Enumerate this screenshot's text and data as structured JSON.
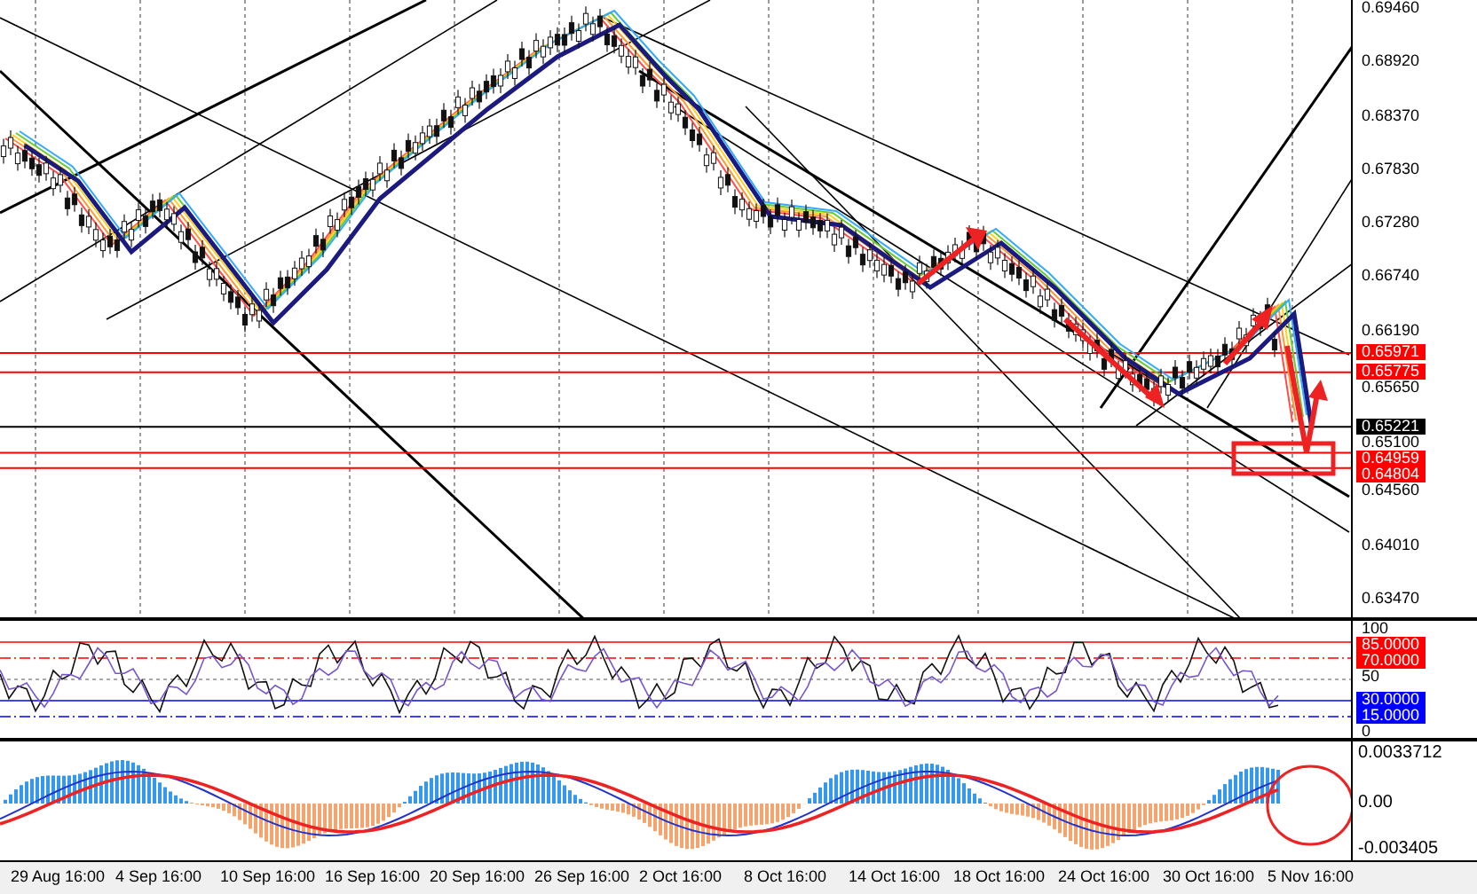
{
  "price_axis": {
    "labels": [
      "0.69460",
      "0.68920",
      "0.68370",
      "0.67830",
      "0.67280",
      "0.66740",
      "0.66190",
      "0.65650",
      "0.65100",
      "0.64560",
      "0.64010",
      "0.63470"
    ]
  },
  "price_tags": [
    {
      "value": "0.65971",
      "color": "#ff0000"
    },
    {
      "value": "0.65775",
      "color": "#ff0000"
    },
    {
      "value": "0.65221",
      "color": "#000000"
    },
    {
      "value": "0.64959",
      "color": "#ff0000"
    },
    {
      "value": "0.64804",
      "color": "#ff0000"
    }
  ],
  "rsi_axis": {
    "labels": [
      "100",
      "50",
      "0"
    ]
  },
  "rsi_levels": [
    {
      "value": "85.0000",
      "color": "#ff0000"
    },
    {
      "value": "70.0000",
      "color": "#ff0000"
    },
    {
      "value": "30.0000",
      "color": "#0000ff"
    },
    {
      "value": "15.0000",
      "color": "#0000ff"
    }
  ],
  "macd_axis": {
    "labels": [
      "0.0033712",
      "0.00",
      "-0.003405"
    ]
  },
  "time_axis": {
    "labels": [
      "29 Aug 16:00",
      "4 Sep 16:00",
      "10 Sep 16:00",
      "16 Sep 16:00",
      "20 Sep 16:00",
      "26 Sep 16:00",
      "2 Oct 16:00",
      "8 Oct 16:00",
      "14 Oct 16:00",
      "18 Oct 16:00",
      "24 Oct 16:00",
      "30 Oct 16:00",
      "5 Nov 16:00"
    ]
  }
}
